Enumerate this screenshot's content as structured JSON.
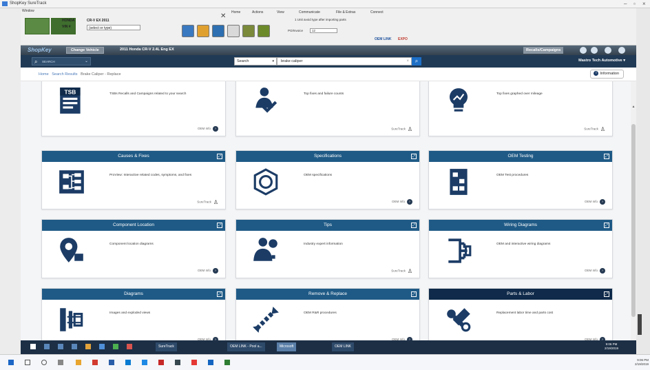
{
  "window": {
    "title": "ShopKey SureTrack",
    "menu": "Window"
  },
  "toolbar": {
    "make_label": "HONDA",
    "model_value": "CR-V EX 2011",
    "vin_label": "VIN #",
    "vin_value": "(select or type)",
    "home_label": "Home",
    "actions_label": "Actions",
    "view_label": "View",
    "communicate_label": "Communicate",
    "files_label": "File & Extras",
    "connect_label": "Connect",
    "close_glyph": "✕",
    "note_text": "1 Unit avoid type after importing parts",
    "po_label": "PO/Invoice",
    "po_value": "12",
    "oem_link": "OEM LINK",
    "oem_badge": "EXPO"
  },
  "nav": {
    "logo": "ShopKey",
    "change_vehicle": "Change Vehicle",
    "vehicle": "2011 Honda CR-V 2.4L Eng EX",
    "recalls": "Recalls/Campaigns"
  },
  "search": {
    "quick_label": "SEARCH",
    "scope": "Search",
    "query": "brake caliper",
    "account": "Mastro Tech Automotive"
  },
  "breadcrumb": {
    "home": "Home",
    "results": "Search Results",
    "current": "Brake Caliper - Replace"
  },
  "info_button": "Information",
  "cards": [
    {
      "title": "",
      "desc": "TSBs Recalls and Campaigns related to your search",
      "footer": "OEM Info",
      "footer_kind": "info",
      "icon": "tsb-icon"
    },
    {
      "title": "",
      "desc": "Top fixes and failure counts",
      "footer": "SureTrack",
      "footer_kind": "person",
      "icon": "technician-icon"
    },
    {
      "title": "",
      "desc": "Top fixes graphed over mileage",
      "footer": "SureTrack",
      "footer_kind": "person",
      "icon": "lightbulb-graph-icon"
    },
    {
      "title": "Causes & Fixes",
      "desc": "ProView: Interactive related codes, symptoms, and fixes",
      "footer": "SureTrack",
      "footer_kind": "person",
      "icon": "flowchart-icon"
    },
    {
      "title": "Specifications",
      "desc": "OEM specifications",
      "footer": "OEM Info",
      "footer_kind": "info",
      "icon": "nut-icon"
    },
    {
      "title": "OEM Testing",
      "desc": "OEM Test procedures",
      "footer": "OEM Info",
      "footer_kind": "info",
      "icon": "test-diagram-icon"
    },
    {
      "title": "Component Location",
      "desc": "Component location diagrams",
      "footer": "OEM Info",
      "footer_kind": "info",
      "icon": "location-pin-icon"
    },
    {
      "title": "Tips",
      "desc": "Industry expert information",
      "footer": "SureTrack",
      "footer_kind": "person",
      "icon": "expert-icon"
    },
    {
      "title": "Wiring Diagrams",
      "desc": "OEM and interactive wiring diagrams",
      "footer": "OEM Info",
      "footer_kind": "info",
      "icon": "wiring-icon"
    },
    {
      "title": "Diagrams",
      "desc": "Images and exploded views",
      "footer": "OEM Info",
      "footer_kind": "info",
      "icon": "exploded-view-icon"
    },
    {
      "title": "Remove & Replace",
      "desc": "OEM R&R procedures",
      "footer": "OEM Info",
      "footer_kind": "info",
      "icon": "remove-replace-icon"
    },
    {
      "title": "Parts & Labor",
      "desc": "Replacement labor time and parts cost",
      "footer": "OEM Info",
      "footer_kind": "info",
      "icon": "parts-labor-icon"
    }
  ],
  "taskbar": {
    "task1": "SureTrack",
    "task2": "OEM LINK - Pool a...",
    "task3": "Microsoft",
    "task4": "OEM LINK",
    "time": "9:06 PM",
    "date": "2/19/2019"
  },
  "colors": {
    "header_blue": "#1f5a86",
    "header_dark": "#0f2a4a",
    "nav_bg": "#203a55"
  }
}
